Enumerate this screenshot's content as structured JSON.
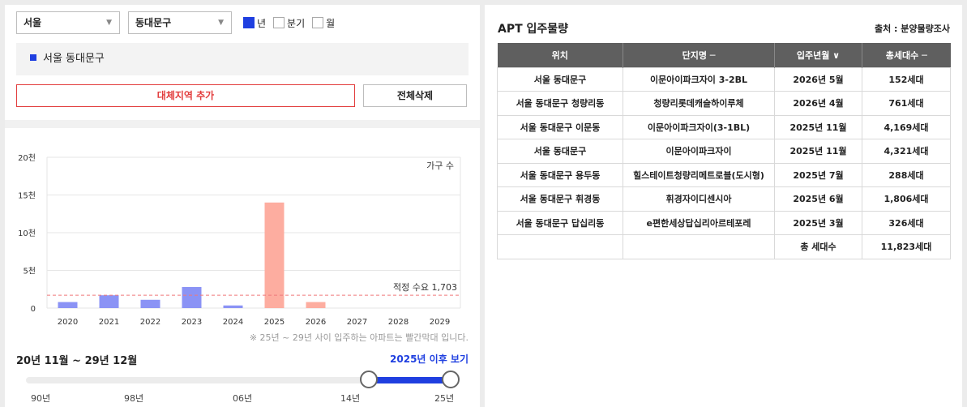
{
  "filters": {
    "city": "서울",
    "district": "동대문구",
    "periods": [
      {
        "label": "년",
        "checked": true
      },
      {
        "label": "분기",
        "checked": false
      },
      {
        "label": "월",
        "checked": false
      }
    ]
  },
  "selected_region": "서울 동대문구",
  "buttons": {
    "add_region": "대체지역 추가",
    "delete_all": "전체삭제"
  },
  "chart_data": {
    "type": "bar",
    "categories": [
      "2020",
      "2021",
      "2022",
      "2023",
      "2024",
      "2025",
      "2026",
      "2027",
      "2028",
      "2029"
    ],
    "values": [
      800,
      1700,
      1100,
      2800,
      350,
      14000,
      800,
      0,
      0,
      0
    ],
    "highlight_from": "2025",
    "colors": {
      "normal": "#8b93f5",
      "highlight": "#fdada0",
      "reference": "#f0797b"
    },
    "ylim": [
      0,
      20000
    ],
    "yticks": [
      {
        "value": 0,
        "label": "0"
      },
      {
        "value": 5000,
        "label": "5천"
      },
      {
        "value": 10000,
        "label": "10천"
      },
      {
        "value": 15000,
        "label": "15천"
      },
      {
        "value": 20000,
        "label": "20천"
      }
    ],
    "legend": "가구 수",
    "reference_line": {
      "value": 1703,
      "label": "적정 수요 1,703"
    }
  },
  "footnote": "※ 25년 ~ 29년 사이 입주하는 아파트는 빨간막대 입니다.",
  "range_label": "20년 11월 ~ 29년 12월",
  "after_link": "2025년 이후 보기",
  "slider": {
    "labels": [
      "90년",
      "98년",
      "06년",
      "14년",
      "25년"
    ],
    "start": "20년",
    "end": "29년"
  },
  "table": {
    "title": "APT 입주물량",
    "source": "출처 : 분양물량조사",
    "headers": [
      "위치",
      "단지명 ─",
      "입주년월 ∨",
      "총세대수 ─"
    ],
    "rows": [
      [
        "서울 동대문구",
        "이문아이파크자이 3-2BL",
        "2026년 5월",
        "152세대"
      ],
      [
        "서울 동대문구 청량리동",
        "청량리롯데캐슬하이루체",
        "2026년 4월",
        "761세대"
      ],
      [
        "서울 동대문구 이문동",
        "이문아이파크자이(3-1BL)",
        "2025년 11월",
        "4,169세대"
      ],
      [
        "서울 동대문구",
        "이문아이파크자이",
        "2025년 11월",
        "4,321세대"
      ],
      [
        "서울 동대문구 용두동",
        "힐스테이트청량리메트로블(도시형)",
        "2025년 7월",
        "288세대"
      ],
      [
        "서울 동대문구 휘경동",
        "휘경자이디센시아",
        "2025년 6월",
        "1,806세대"
      ],
      [
        "서울 동대문구 답십리동",
        "e편한세상답십리아르테포레",
        "2025년 3월",
        "326세대"
      ]
    ],
    "total": {
      "label": "총 세대수",
      "value": "11,823세대"
    }
  }
}
